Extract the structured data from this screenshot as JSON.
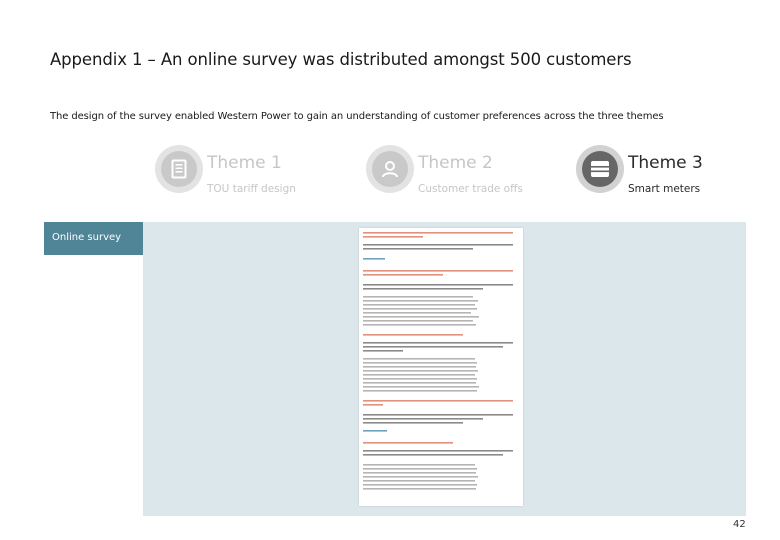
{
  "header": {
    "title": "Appendix 1 – An online survey was distributed amongst 500 customers",
    "subtitle": "The design of the survey enabled Western Power to gain an understanding of customer preferences across the three themes"
  },
  "themes": [
    {
      "title": "Theme 1",
      "subtitle": "TOU tariff design",
      "icon": "document-icon",
      "active": false
    },
    {
      "title": "Theme 2",
      "subtitle": "Customer trade offs",
      "icon": "person-icon",
      "active": false
    },
    {
      "title": "Theme 3",
      "subtitle": "Smart meters",
      "icon": "meter-icon",
      "active": true
    }
  ],
  "section_tab": {
    "label": "Online survey"
  },
  "survey_document": {
    "description_visible": false
  },
  "page_number": "42",
  "colors": {
    "tab": "#4f8596",
    "panel": "#dce7ec",
    "inactive_text": "#c6c6c6",
    "active_icon": "#666666"
  }
}
